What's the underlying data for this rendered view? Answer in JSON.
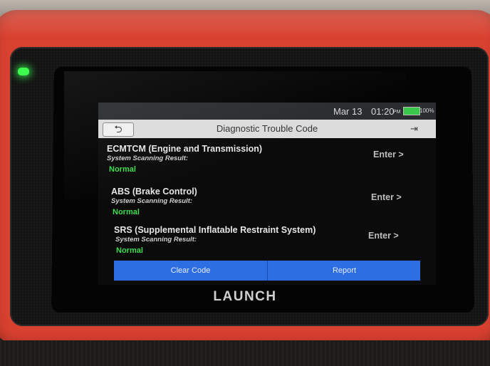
{
  "status_bar": {
    "date": "Mar 13",
    "time": "01:20",
    "ampm": "PM",
    "battery": "100%",
    "battery_color": "#39c84a"
  },
  "title_bar": {
    "title": "Diagnostic Trouble Code",
    "back_icon": "back-arrow-icon",
    "exit_icon": "exit-icon"
  },
  "systems": [
    {
      "name": "ECMTCM (Engine and Transmission)",
      "result_label": "System Scanning Result:",
      "status": "Normal",
      "enter_label": "Enter >"
    },
    {
      "name": "ABS (Brake Control)",
      "result_label": "System Scanning Result:",
      "status": "Normal",
      "enter_label": "Enter >"
    },
    {
      "name": "SRS (Supplemental Inflatable Restraint System)",
      "result_label": "System Scanning Result:",
      "status": "Normal",
      "enter_label": "Enter >"
    }
  ],
  "actions": {
    "clear_code": "Clear Code",
    "report": "Report"
  },
  "device": {
    "brand": "LAUNCH",
    "case_color": "#d8402f",
    "accent_color": "#2e6ee3",
    "status_ok_color": "#3fdc4d"
  }
}
